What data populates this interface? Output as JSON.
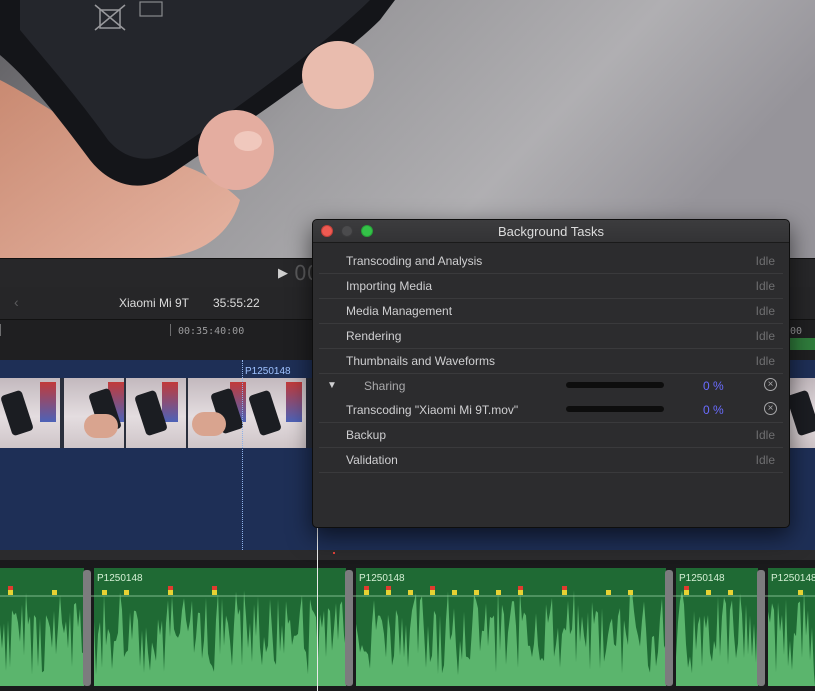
{
  "viewer": {
    "timecode": "00"
  },
  "timeline": {
    "project_name": "Xiaomi Mi 9T",
    "project_duration": "35:55:22",
    "ruler_labels": [
      "00:35:40:00",
      "00"
    ],
    "video_clip_name": "P1250148",
    "audio_clip_names": [
      "P1250148",
      "P1250148",
      "P1250148",
      "P1250148"
    ]
  },
  "background_tasks": {
    "title": "Background Tasks",
    "tasks": [
      {
        "name": "Transcoding and Analysis",
        "status": "Idle"
      },
      {
        "name": "Importing Media",
        "status": "Idle"
      },
      {
        "name": "Media Management",
        "status": "Idle"
      },
      {
        "name": "Rendering",
        "status": "Idle"
      },
      {
        "name": "Thumbnails and Waveforms",
        "status": "Idle"
      },
      {
        "name": "Sharing",
        "progress": 0,
        "percent_label": "0 %",
        "expanded": true
      },
      {
        "name": "Transcoding \"Xiaomi Mi 9T.mov\"",
        "progress": 0,
        "percent_label": "0 %",
        "sub": true
      },
      {
        "name": "Backup",
        "status": "Idle"
      },
      {
        "name": "Validation",
        "status": "Idle"
      }
    ],
    "colors": {
      "close": "#ee5a52",
      "zoom": "#34c248",
      "percent": "#6a6cff"
    }
  },
  "icons": {
    "play": "▶",
    "back": "‹",
    "disclosure_open": "▼",
    "cancel": "×"
  }
}
